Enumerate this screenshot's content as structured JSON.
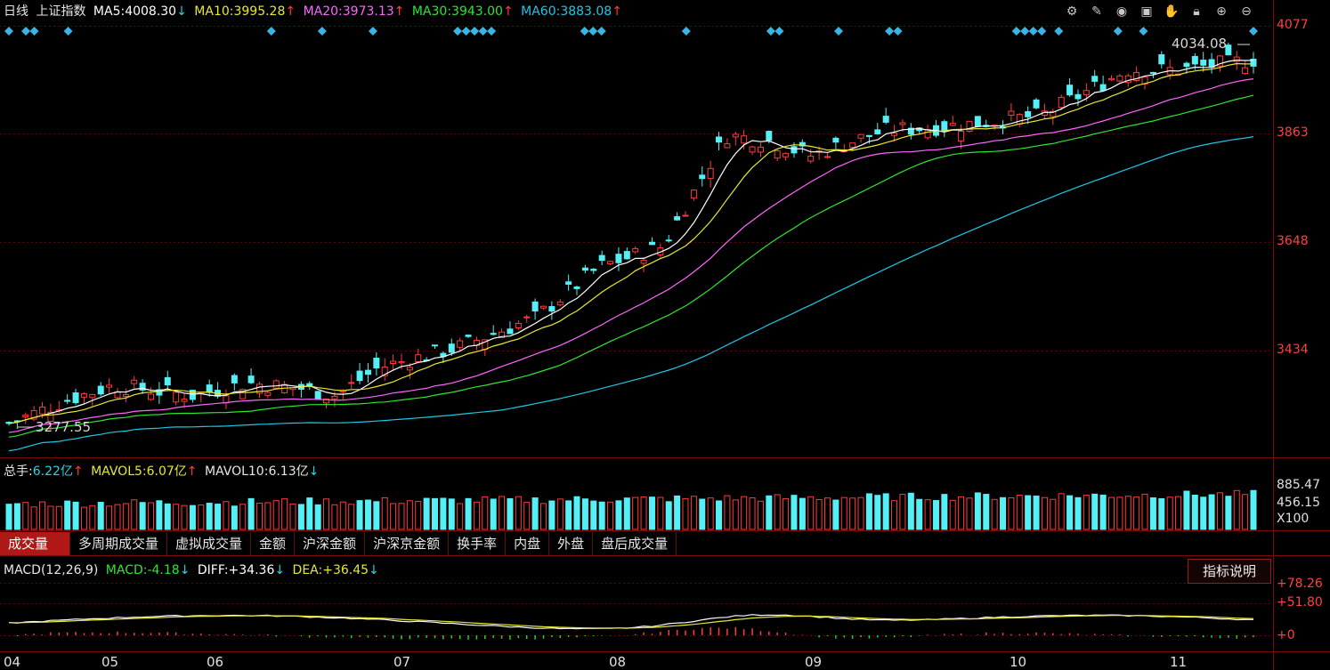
{
  "header": {
    "period": "日线",
    "name": "上证指数",
    "ma5_label": "MA5:",
    "ma5_value": "4008.30",
    "ma5_arrow": "↓",
    "ma10_label": "MA10:",
    "ma10_value": "3995.28",
    "ma10_arrow": "↑",
    "ma20_label": "MA20:",
    "ma20_value": "3973.13",
    "ma20_arrow": "↑",
    "ma30_label": "MA30:",
    "ma30_value": "3943.00",
    "ma30_arrow": "↑",
    "ma60_label": "MA60:",
    "ma60_value": "3883.08",
    "ma60_arrow": "↑"
  },
  "toolbar_icons": [
    "gear-icon",
    "brush-icon",
    "eye-icon",
    "toolbox-icon",
    "hand-icon",
    "lock-icon",
    "zoom-in-icon",
    "zoom-out-icon"
  ],
  "price_axis": [
    "4077",
    "3863",
    "3648",
    "3434"
  ],
  "annotations": {
    "high": "4034.08",
    "low": "3277.55"
  },
  "volume_header": {
    "total_label": "总手:",
    "total_value": "6.22亿",
    "total_arrow": "↑",
    "mavol5_label": "MAVOL5:",
    "mavol5_value": "6.07亿",
    "mavol5_arrow": "↑",
    "mavol10_label": "MAVOL10:",
    "mavol10_value": "6.13亿",
    "mavol10_arrow": "↓"
  },
  "volume_axis": [
    "885.47",
    "456.15",
    "X100"
  ],
  "tabs": [
    "成交量",
    "多周期成交量",
    "虚拟成交量",
    "金额",
    "沪深金额",
    "沪深京金额",
    "换手率",
    "内盘",
    "外盘",
    "盘后成交量"
  ],
  "macd_header": {
    "name": "MACD(12,26,9)",
    "macd_label": "MACD:",
    "macd_value": "-4.18",
    "macd_arrow": "↓",
    "diff_label": "DIFF:",
    "diff_value": "+34.36",
    "diff_arrow": "↓",
    "dea_label": "DEA:",
    "dea_value": "+36.45",
    "dea_arrow": "↓"
  },
  "macd_axis": [
    "+78.26",
    "+51.80",
    "+0"
  ],
  "explain_button": "指标说明",
  "x_axis": [
    "04",
    "05",
    "06",
    "07",
    "08",
    "09",
    "10",
    "11"
  ],
  "colors": {
    "up": "#ff3b3b",
    "down": "#54f0f5",
    "ma5": "#ffffff",
    "ma10": "#e8e832",
    "ma20": "#ff66ff",
    "ma30": "#2ee62e",
    "ma60": "#1ec8e6",
    "grid": "#7a0a0a"
  },
  "chart_data": {
    "type": "candlestick",
    "y_range": [
      3277.55,
      4077
    ],
    "series_summary": {
      "start_close": 3290,
      "high": 4034.08,
      "low": 3277.55,
      "end_close": 4008
    }
  }
}
